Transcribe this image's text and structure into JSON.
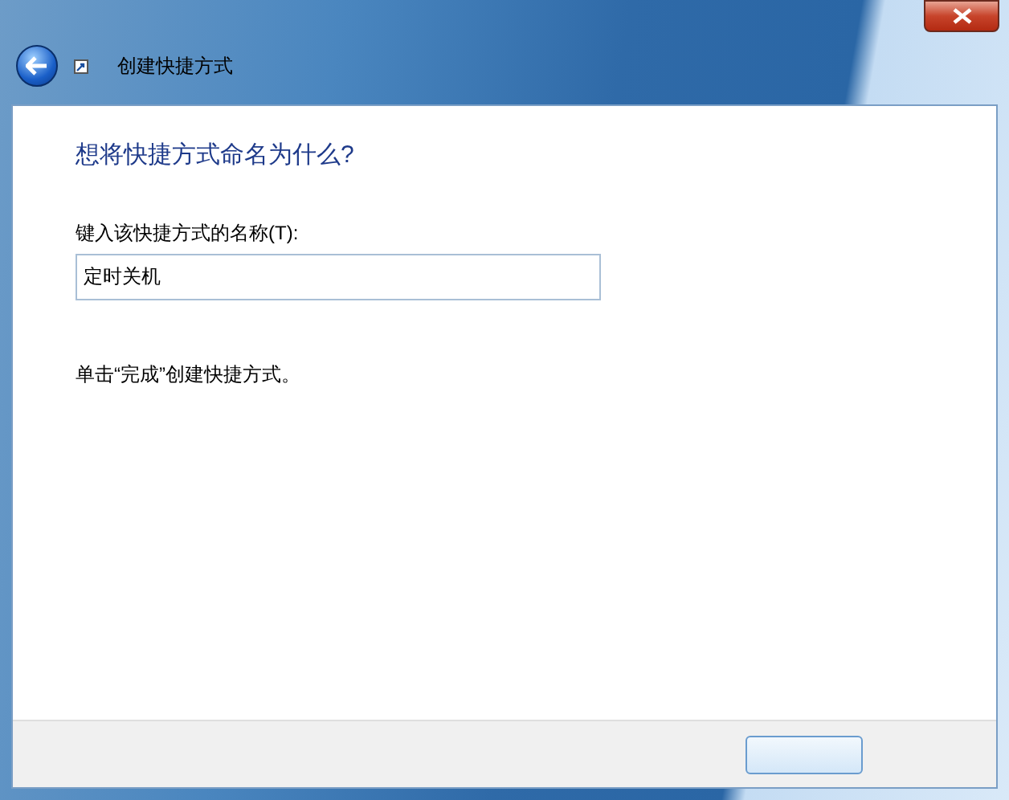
{
  "window": {
    "title": "创建快捷方式"
  },
  "content": {
    "heading": "想将快捷方式命名为什么?",
    "name_field": {
      "label": "键入该快捷方式的名称(T):",
      "value": "定时关机"
    },
    "hint": "单击“完成”创建快捷方式。"
  }
}
